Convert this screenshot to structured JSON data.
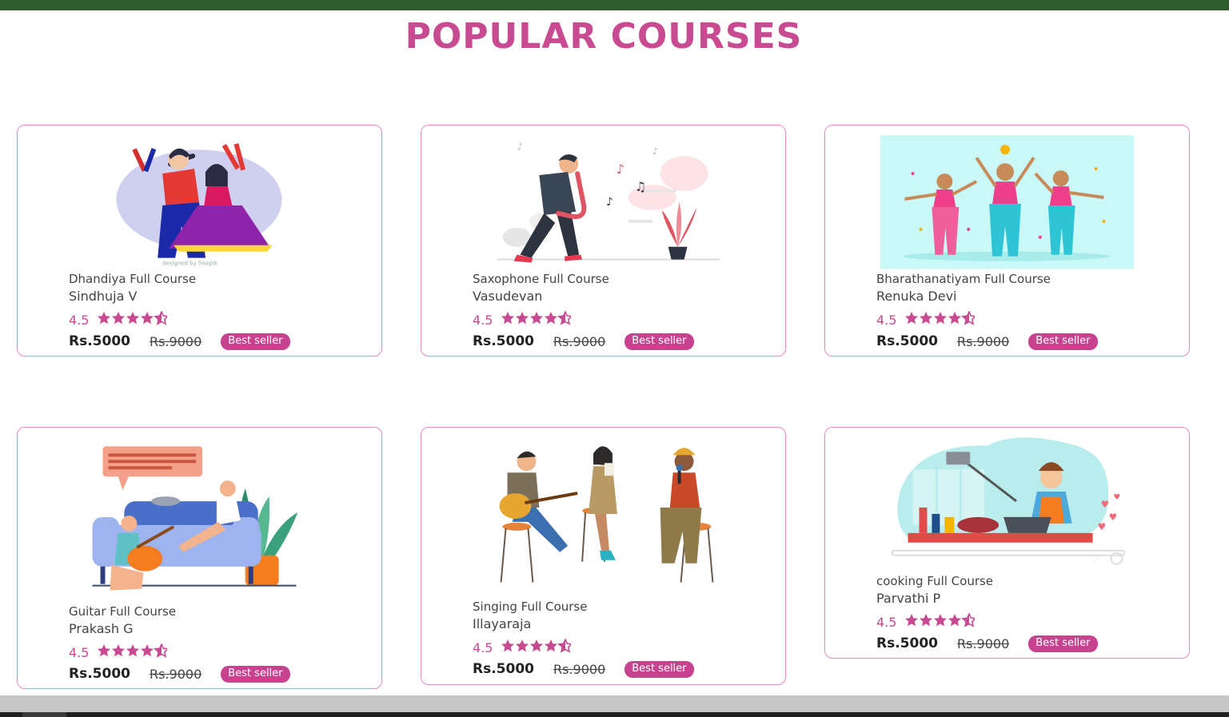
{
  "header": {
    "title": "POPULAR COURSES"
  },
  "colors": {
    "accent": "#c84b92",
    "top_bar": "#2f5d2e",
    "card_border": "#e58ac7"
  },
  "courses": [
    {
      "title": "Dhandiya Full Course",
      "instructor": "Sindhuja V",
      "rating": "4.5",
      "rating_value": 4.5,
      "price": "Rs.5000",
      "old_price": "Rs.9000",
      "badge": "Best seller",
      "image": "dandiya-dancers-illustration"
    },
    {
      "title": "Saxophone Full Course",
      "instructor": "Vasudevan",
      "rating": "4.5",
      "rating_value": 4.5,
      "price": "Rs.5000",
      "old_price": "Rs.9000",
      "badge": "Best seller",
      "image": "saxophone-player-illustration"
    },
    {
      "title": "Bharathanatiyam Full Course",
      "instructor": "Renuka Devi",
      "rating": "4.5",
      "rating_value": 4.5,
      "price": "Rs.5000",
      "old_price": "Rs.9000",
      "badge": "Best seller",
      "image": "bharatanatyam-dancers-illustration"
    },
    {
      "title": "Guitar Full Course",
      "instructor": "Prakash G",
      "rating": "4.5",
      "rating_value": 4.5,
      "price": "Rs.5000",
      "old_price": "Rs.9000",
      "badge": "Best seller",
      "image": "guitar-on-sofa-illustration"
    },
    {
      "title": "Singing Full Course",
      "instructor": "Illayaraja",
      "rating": "4.5",
      "rating_value": 4.5,
      "price": "Rs.5000",
      "old_price": "Rs.9000",
      "badge": "Best seller",
      "image": "singers-on-stools-illustration"
    },
    {
      "title": "cooking Full Course",
      "instructor": "Parvathi P",
      "rating": "4.5",
      "rating_value": 4.5,
      "price": "Rs.5000",
      "old_price": "Rs.9000",
      "badge": "Best seller",
      "image": "cooking-vlogger-illustration"
    }
  ]
}
